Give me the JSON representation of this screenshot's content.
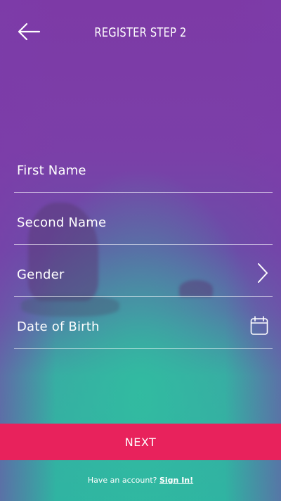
{
  "header": {
    "title": "REGISTER STEP 2",
    "back_icon": "arrow-left-icon"
  },
  "form": {
    "fields": [
      {
        "label": "First Name"
      },
      {
        "label": "Second Name"
      },
      {
        "label": "Gender",
        "icon": "chevron-right-icon"
      },
      {
        "label": "Date of Birth",
        "icon": "calendar-icon"
      }
    ]
  },
  "actions": {
    "next_label": "NEXT"
  },
  "footer": {
    "prompt": "Have an account?",
    "signin_label": "Sign In!"
  },
  "colors": {
    "primary_button": "#e8225c",
    "gradient_top": "#7d3aa6",
    "gradient_bottom": "#2fb2a2"
  }
}
